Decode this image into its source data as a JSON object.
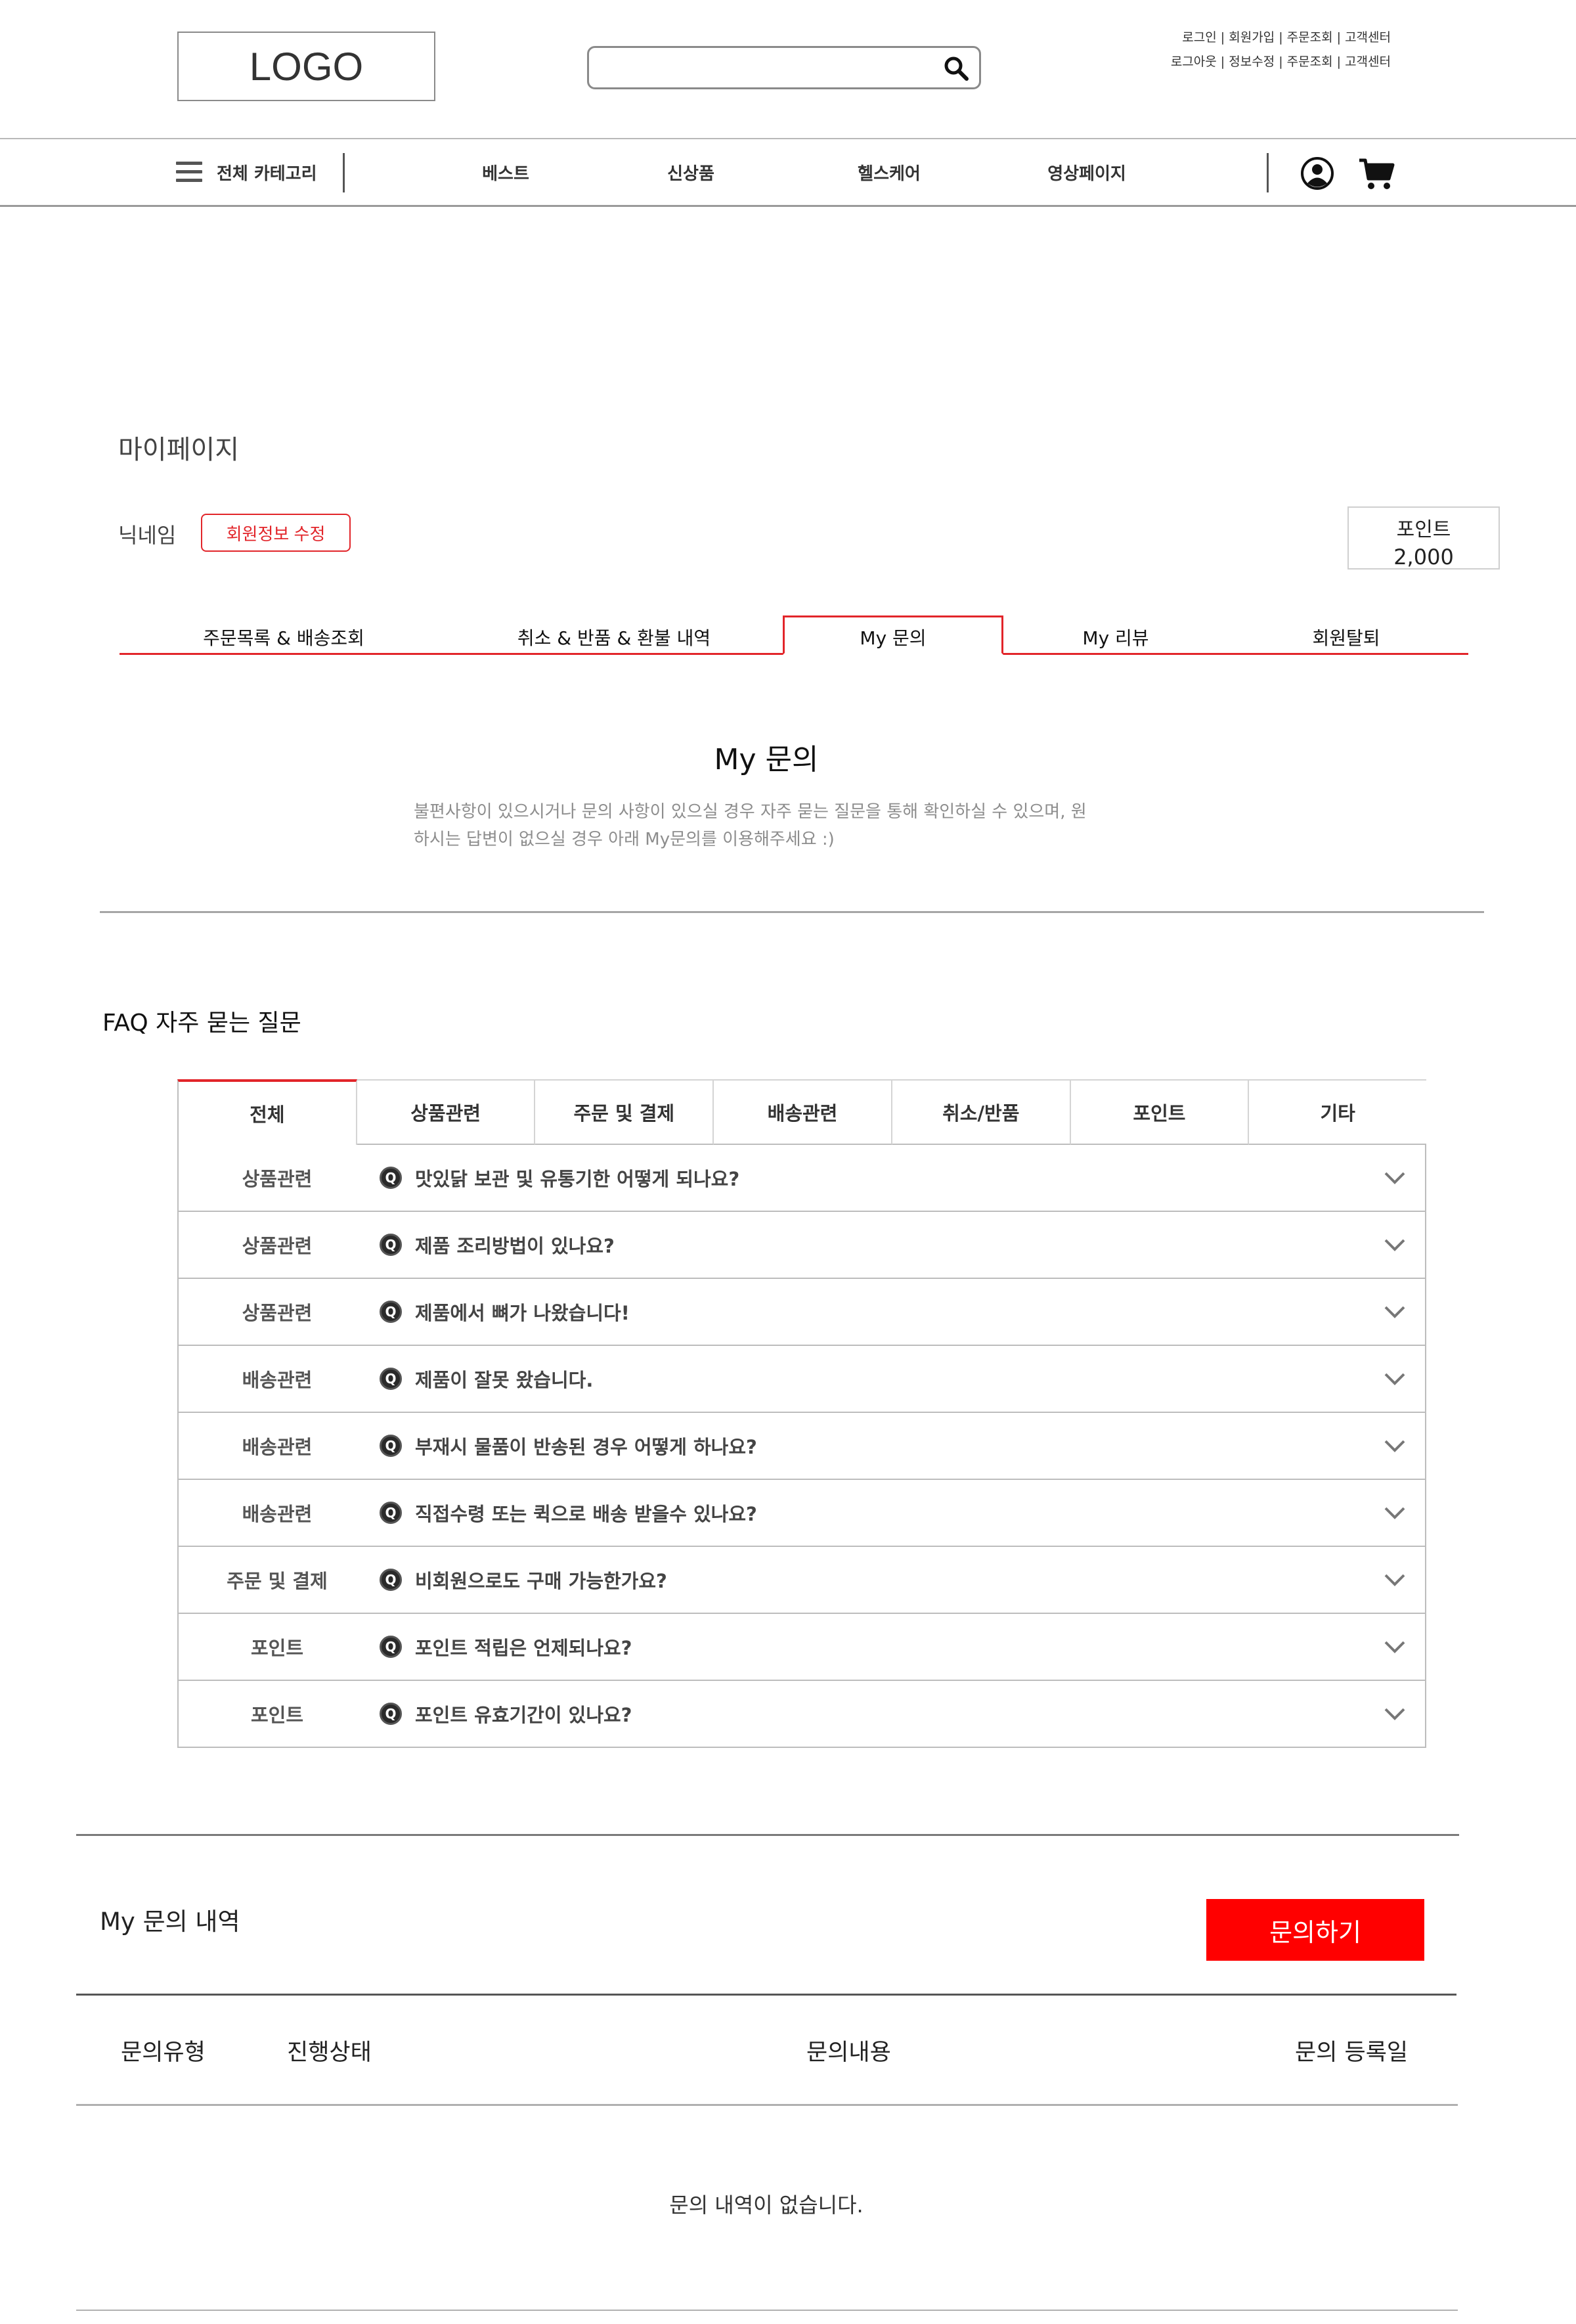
{
  "header": {
    "logo": "LOGO",
    "search_placeholder": "",
    "util_row1": [
      "로그인",
      "회원가입",
      "주문조회",
      "고객센터"
    ],
    "util_row2": [
      "로그아웃",
      "정보수정",
      "주문조회",
      "고객센터"
    ],
    "separator": "|"
  },
  "nav": {
    "all_category": "전체 카테고리",
    "items": [
      "베스트",
      "신상품",
      "헬스케어",
      "영상페이지"
    ]
  },
  "mypage": {
    "title": "마이페이지",
    "nickname": "닉네임",
    "edit_button": "회원정보 수정",
    "point_label": "포인트",
    "point_value": "2,000",
    "tabs": [
      "주문목록 & 배송조회",
      "취소 & 반품 & 환불 내역",
      "My 문의",
      "My 리뷰",
      "회원탈퇴"
    ],
    "active_tab": "My 문의"
  },
  "inquiry_intro": {
    "title": "My 문의",
    "desc_line1": "불편사항이 있으시거나 문의 사항이 있으실 경우 자주 묻는 질문을 통해 확인하실 수 있으며, 원",
    "desc_line2": "하시는 답변이 없으실 경우 아래 My문의를 이용해주세요 :)"
  },
  "faq": {
    "title": "FAQ 자주 묻는 질문",
    "tabs": [
      "전체",
      "상품관련",
      "주문 및 결제",
      "배송관련",
      "취소/반품",
      "포인트",
      "기타"
    ],
    "active_tab": "전체",
    "q_badge": "Q",
    "items": [
      {
        "category": "상품관련",
        "question": "맛있닭 보관 및 유통기한 어떻게 되나요?"
      },
      {
        "category": "상품관련",
        "question": "제품 조리방법이 있나요?"
      },
      {
        "category": "상품관련",
        "question": "제품에서 뼈가 나왔습니다!"
      },
      {
        "category": "배송관련",
        "question": "제품이 잘못 왔습니다."
      },
      {
        "category": "배송관련",
        "question": "부재시 물품이 반송된 경우 어떻게 하나요?"
      },
      {
        "category": "배송관련",
        "question": "직접수령 또는 퀵으로 배송 받을수 있나요?"
      },
      {
        "category": "주문 및 결제",
        "question": "비회원으로도 구매 가능한가요?"
      },
      {
        "category": "포인트",
        "question": "포인트 적립은 언제되나요?"
      },
      {
        "category": "포인트",
        "question": "포인트 유효기간이 있나요?"
      }
    ]
  },
  "my_inquiry": {
    "title": "My 문의 내역",
    "button": "문의하기",
    "columns": [
      "문의유형",
      "진행상태",
      "문의내용",
      "문의 등록일"
    ],
    "empty": "문의 내역이 없습니다."
  },
  "colors": {
    "accent": "#e2252a",
    "button_red": "#ff0000",
    "muted_text": "#8d8d8d"
  }
}
